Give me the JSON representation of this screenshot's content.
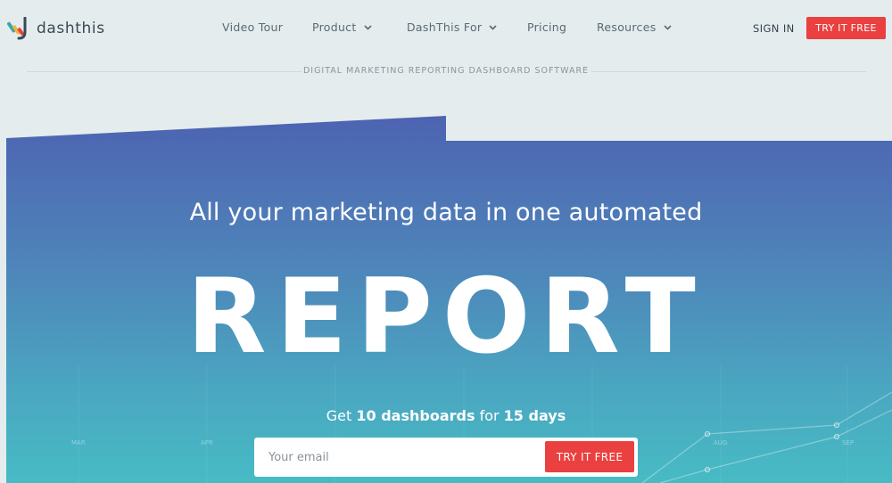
{
  "brand": {
    "name": "dashthis"
  },
  "nav": {
    "video_tour": "Video Tour",
    "product": "Product",
    "dashthis_for": "DashThis For",
    "pricing": "Pricing",
    "resources": "Resources"
  },
  "header": {
    "sign_in": "SIGN IN",
    "try_free": "TRY IT FREE",
    "tagline": "DIGITAL MARKETING REPORTING DASHBOARD SOFTWARE"
  },
  "hero": {
    "headline": "All your marketing data in one automated",
    "big_word": "REPORT",
    "offer_prefix": "Get ",
    "offer_dashboards": "10 dashboards",
    "offer_middle": " for ",
    "offer_days": "15 days",
    "email_placeholder": "Your email",
    "cta": "TRY IT FREE",
    "month_labels": [
      "MAR",
      "APR",
      "AUG",
      "SEP"
    ]
  },
  "colors": {
    "accent": "#ea4040",
    "hero_top": "#4d63b2",
    "hero_bottom": "#47bbc4",
    "page_bg": "#e4ecee"
  }
}
